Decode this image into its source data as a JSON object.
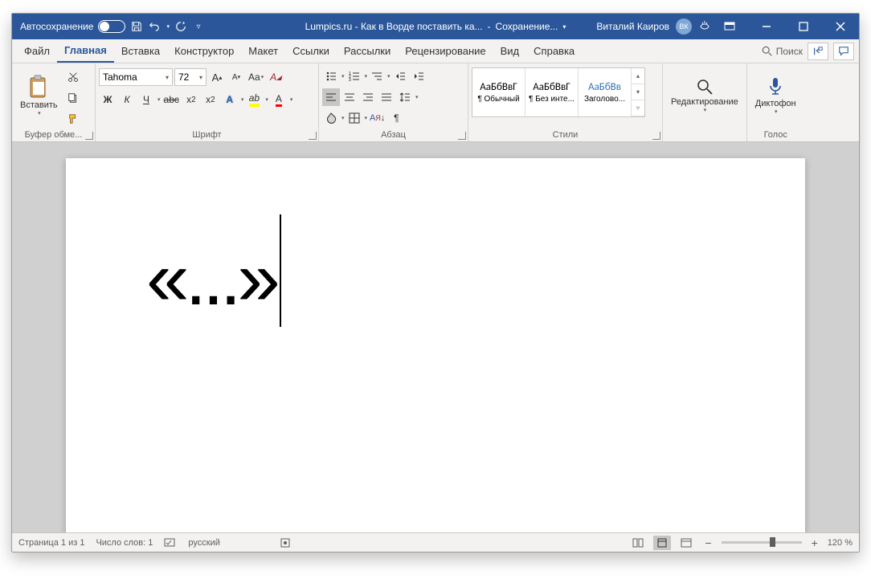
{
  "titlebar": {
    "autosave": "Автосохранение",
    "doc_title": "Lumpics.ru - Как в Ворде поставить ка...",
    "save_status": "Сохранение...",
    "user": "Виталий Каиров",
    "avatar": "ВК"
  },
  "tabs": {
    "items": [
      "Файл",
      "Главная",
      "Вставка",
      "Конструктор",
      "Макет",
      "Ссылки",
      "Рассылки",
      "Рецензирование",
      "Вид",
      "Справка"
    ],
    "active": 1,
    "search": "Поиск"
  },
  "ribbon": {
    "clipboard": {
      "label": "Буфер обме...",
      "paste": "Вставить"
    },
    "font": {
      "label": "Шрифт",
      "name": "Tahoma",
      "size": "72",
      "bold": "Ж",
      "italic": "К",
      "underline": "Ч",
      "strike": "abc",
      "sub": "x₂",
      "sup": "x²"
    },
    "paragraph": {
      "label": "Абзац"
    },
    "styles": {
      "label": "Стили",
      "items": [
        {
          "prev": "АаБбВвГ",
          "name": "¶ Обычный"
        },
        {
          "prev": "АаБбВвГ",
          "name": "¶ Без инте..."
        },
        {
          "prev": "АаБбВв",
          "name": "Заголово..."
        }
      ]
    },
    "editing": {
      "label": "Редактирование"
    },
    "voice": {
      "label": "Голос",
      "dictate": "Диктофон"
    }
  },
  "document": {
    "text": "«...»"
  },
  "statusbar": {
    "page": "Страница 1 из 1",
    "words": "Число слов: 1",
    "lang": "русский",
    "zoom": "120 %"
  }
}
